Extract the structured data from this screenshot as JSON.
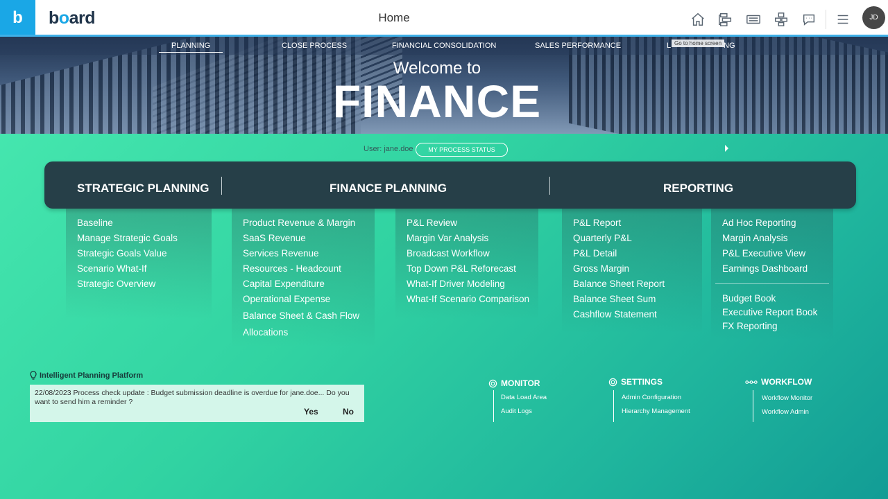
{
  "app": {
    "badge": "b",
    "logo_left": "b",
    "logo_o": "o",
    "logo_right": "ard",
    "title": "Home"
  },
  "topbar": {
    "icons": [
      "home-icon",
      "hierarchy-icon",
      "keyboard-icon",
      "network-icon",
      "chat-icon",
      "menu-icon"
    ],
    "avatar": "JD"
  },
  "nav": {
    "items": [
      "PLANNING",
      "CLOSE PROCESS",
      "FINANCIAL CONSOLIDATION",
      "SALES PERFORMANCE",
      "L",
      "NG"
    ],
    "tooltip": "Go to home screen",
    "active": "PLANNING"
  },
  "hero": {
    "welcome": "Welcome to",
    "title": "FINANCE"
  },
  "user": {
    "label": "User: jane.doe",
    "status_button": "MY PROCESS STATUS"
  },
  "sections": {
    "strategic": "STRATEGIC PLANNING",
    "finance": "FINANCE PLANNING",
    "reporting": "REPORTING"
  },
  "columns": {
    "strategic": [
      "Baseline",
      "Manage Strategic Goals",
      "Strategic Goals Value",
      "Scenario What-If",
      "Strategic Overview"
    ],
    "finance_a": [
      "Product Revenue & Margin",
      "SaaS Revenue",
      "Services Revenue",
      "Resources - Headcount",
      "Capital Expenditure",
      "Operational Expense",
      "Balance Sheet & Cash Flow",
      "Allocations"
    ],
    "finance_b": [
      "P&L Review",
      "Margin Var Analysis",
      "Broadcast Workflow",
      "Top Down P&L Reforecast",
      "What-If Driver Modeling",
      "What-If Scenario Comparison"
    ],
    "reporting_a": [
      "P&L Report",
      "Quarterly P&L",
      "P&L Detail",
      "Gross Margin",
      "Balance Sheet Report",
      "Balance Sheet Sum",
      "Cashflow Statement"
    ],
    "reporting_b": [
      "Ad Hoc Reporting",
      "Margin Analysis",
      "P&L Executive View",
      "Earnings Dashboard"
    ],
    "reporting_b_books": [
      "Budget Book",
      "Executive Report Book",
      "FX Reporting"
    ]
  },
  "notification": {
    "title": "Intelligent Planning Platform",
    "message": "22/08/2023 Process check update :  Budget submission deadline is overdue for jane.doe... Do you want to send him a reminder ?",
    "yes": "Yes",
    "no": "No"
  },
  "admin": {
    "monitor": {
      "title": "MONITOR",
      "links": [
        "Data Load Area",
        "Audit Logs"
      ]
    },
    "settings": {
      "title": "SETTINGS",
      "links": [
        "Admin Configuration",
        "Hierarchy Management"
      ]
    },
    "workflow": {
      "title": "WORKFLOW",
      "links": [
        "Workflow Monitor",
        "Workflow Admin"
      ]
    }
  },
  "colors": {
    "accent": "#1aa7e6",
    "band": "#263f48",
    "teal": "#31d3a2"
  }
}
